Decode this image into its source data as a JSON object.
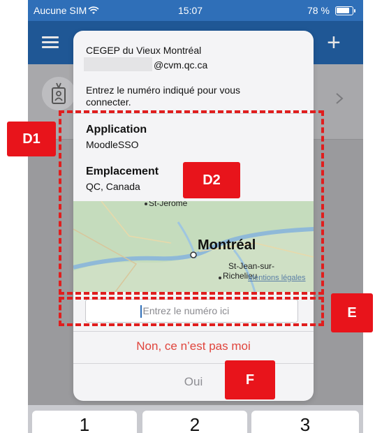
{
  "status_bar": {
    "carrier": "Aucune SIM",
    "time": "15:07",
    "battery": "78 %"
  },
  "dialog": {
    "organization": "CEGEP du Vieux Montréal",
    "email": "@cvm.qc.ca",
    "instruction": "Entrez le numéro indiqué pour vous connecter.",
    "application_label": "Application",
    "application_value": "MoodleSSO",
    "location_label": "Emplacement",
    "location_value": "QC, Canada",
    "map": {
      "city": "Montréal",
      "town_top": "St-Jérome",
      "town_right_1": "St-Jean-sur-",
      "town_right_2": "Richelieu",
      "legal_link": "Mentions légales"
    },
    "input_placeholder": "Entrez le numéro ici",
    "deny_label": "Non, ce n’est pas moi",
    "approve_label": "Oui"
  },
  "keyboard": {
    "keys": [
      "1",
      "2",
      "3"
    ]
  },
  "annotations": {
    "d1": "D1",
    "d2": "D2",
    "e": "E",
    "f": "F"
  },
  "colors": {
    "accent_blue": "#2f6fb8",
    "annotation_red": "#e8141b",
    "deny_red": "#e0443c"
  },
  "icons": [
    "wifi-icon",
    "battery-icon",
    "menu-icon",
    "plus-icon",
    "badge-icon",
    "chevron-right-icon"
  ]
}
